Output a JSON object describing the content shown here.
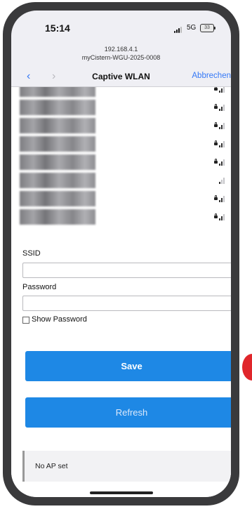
{
  "status_bar": {
    "time": "15:14",
    "network": "5G",
    "battery": "33"
  },
  "url_bar": {
    "host": "192.168.4.1",
    "device": "myCistern-WGU-2025-0008"
  },
  "nav": {
    "back_icon": "chevron-left-icon",
    "forward_icon": "chevron-right-icon",
    "title": "Captive WLAN",
    "cancel": "Abbrechen"
  },
  "networks": [
    {
      "secured": true,
      "bars": 2
    },
    {
      "secured": true,
      "bars": 2
    },
    {
      "secured": true,
      "bars": 2
    },
    {
      "secured": true,
      "bars": 2
    },
    {
      "secured": true,
      "bars": 2
    },
    {
      "secured": false,
      "bars": 1
    },
    {
      "secured": true,
      "bars": 2
    },
    {
      "secured": true,
      "bars": 2
    }
  ],
  "form": {
    "ssid_label": "SSID",
    "ssid_value": "",
    "password_label": "Password",
    "password_value": "",
    "show_password_label": "Show Password",
    "show_password_checked": false
  },
  "buttons": {
    "save": "Save",
    "refresh": "Refresh"
  },
  "status": {
    "text": "No AP set"
  },
  "colors": {
    "accent": "#1e88e5",
    "ios_blue": "#3478f6",
    "marker": "#e0262b"
  }
}
